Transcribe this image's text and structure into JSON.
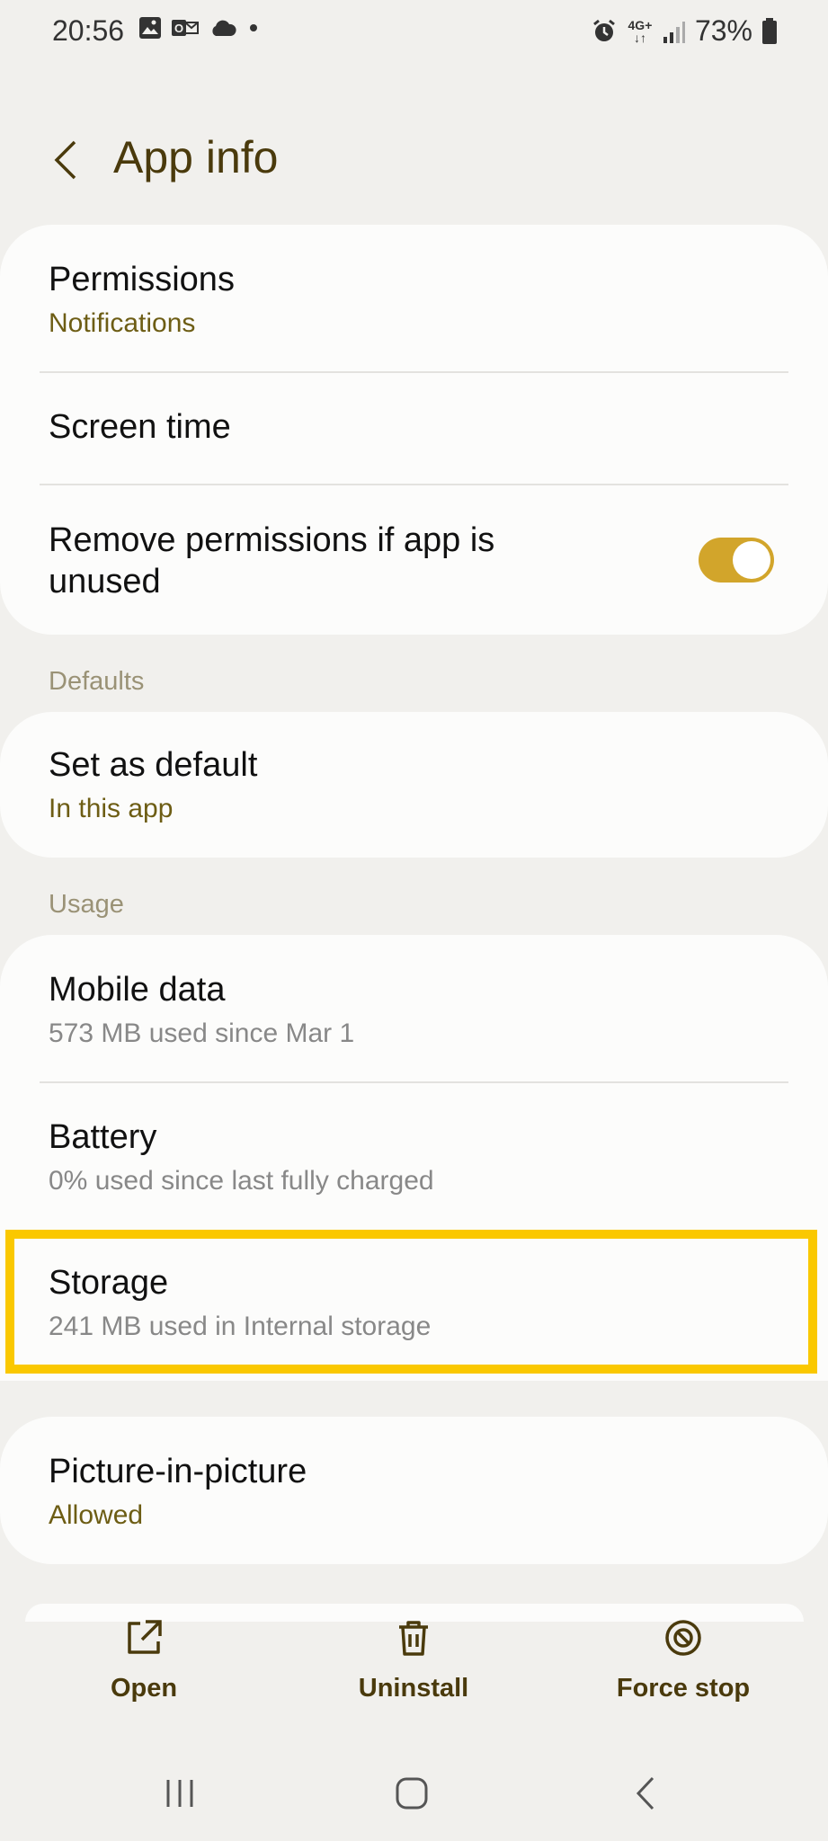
{
  "status_bar": {
    "time": "20:56",
    "network": "4G+",
    "battery": "73%"
  },
  "header": {
    "title": "App info"
  },
  "top_card": {
    "permissions_title": "Permissions",
    "permissions_sub": "Notifications",
    "screen_time": "Screen time",
    "remove_permissions": "Remove permissions if app is unused",
    "remove_permissions_on": true
  },
  "defaults": {
    "section_label": "Defaults",
    "set_default_title": "Set as default",
    "set_default_sub": "In this app"
  },
  "usage": {
    "section_label": "Usage",
    "mobile_data_title": "Mobile data",
    "mobile_data_sub": "573 MB used since Mar 1",
    "battery_title": "Battery",
    "battery_sub": "0% used since last fully charged",
    "storage_title": "Storage",
    "storage_sub": "241 MB used in Internal storage"
  },
  "pip": {
    "title": "Picture-in-picture",
    "sub": "Allowed"
  },
  "actions": {
    "open": "Open",
    "uninstall": "Uninstall",
    "force_stop": "Force stop"
  },
  "colors": {
    "accent": "#d2a52b",
    "highlight": "#fac800",
    "title": "#4a3a0c"
  }
}
